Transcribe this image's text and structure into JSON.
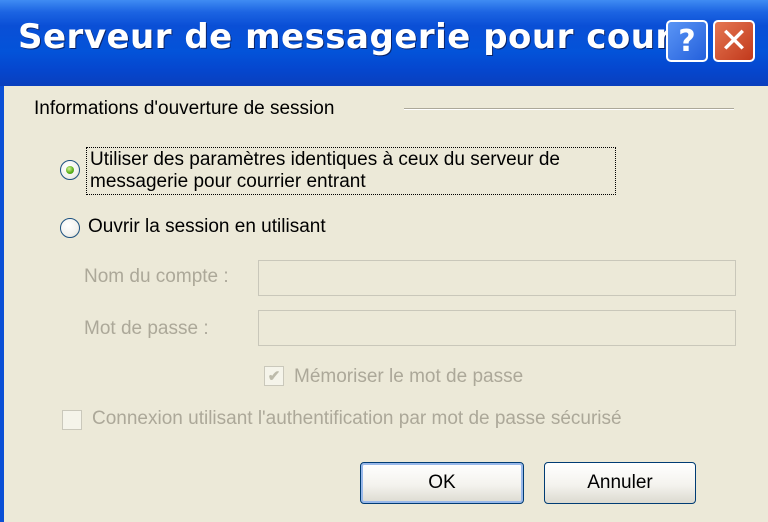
{
  "window": {
    "title": "Serveur de messagerie pour cour…",
    "help_glyph": "?",
    "close_glyph": "✕"
  },
  "logon_group": {
    "label": "Informations d'ouverture de session"
  },
  "options": {
    "use_incoming_settings": {
      "label": "Utiliser des paramètres identiques à ceux du serveur de messagerie pour courrier entrant",
      "selected": true
    },
    "log_on_using": {
      "label": "Ouvrir la session en utilisant",
      "selected": false
    }
  },
  "fields": {
    "account_label": "Nom du compte :",
    "account_value": "",
    "password_label": "Mot de passe :",
    "password_value": ""
  },
  "checkboxes": {
    "remember_password": {
      "label": "Mémoriser le mot de passe",
      "checked": true,
      "enabled": false
    },
    "secure_password_auth": {
      "label": "Connexion utilisant l'authentification par mot de passe sécurisé",
      "checked": false,
      "enabled": false
    }
  },
  "buttons": {
    "ok": "OK",
    "cancel": "Annuler"
  },
  "colors": {
    "titlebar": "#0a4fd6",
    "dialog_bg": "#ece9d8",
    "disabled_text": "#aca899",
    "radio_selected": "#5fb31d",
    "close_button": "#c1391c"
  }
}
